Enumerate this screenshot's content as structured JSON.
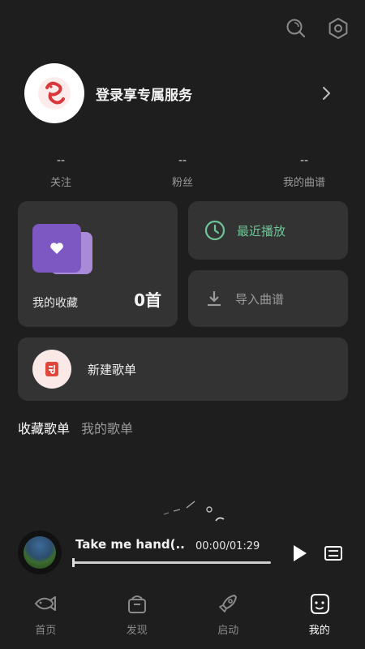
{
  "header": {
    "search_icon": "search-icon",
    "settings_icon": "gear-icon"
  },
  "profile": {
    "login_text": "登录享专属服务"
  },
  "stats": [
    {
      "value": "--",
      "label": "关注"
    },
    {
      "value": "--",
      "label": "粉丝"
    },
    {
      "value": "--",
      "label": "我的曲谱"
    }
  ],
  "favorites": {
    "label": "我的收藏",
    "count": "0首"
  },
  "recent": {
    "label": "最近播放"
  },
  "import": {
    "label": "导入曲谱"
  },
  "new_playlist": {
    "label": "新建歌单"
  },
  "playlist_tabs": [
    {
      "label": "收藏歌单",
      "active": true
    },
    {
      "label": "我的歌单",
      "active": false
    }
  ],
  "player": {
    "title": "Take me hand(..",
    "time": "00:00/01:29",
    "progress": 0
  },
  "nav": [
    {
      "label": "首页",
      "icon": "fish-icon",
      "active": false
    },
    {
      "label": "发现",
      "icon": "basket-icon",
      "active": false
    },
    {
      "label": "启动",
      "icon": "rocket-icon",
      "active": false
    },
    {
      "label": "我的",
      "icon": "face-icon",
      "active": true
    }
  ],
  "colors": {
    "accent": "#6dc596",
    "background": "#1e1e1e",
    "card": "#333333",
    "purple": "#7e58c2"
  }
}
